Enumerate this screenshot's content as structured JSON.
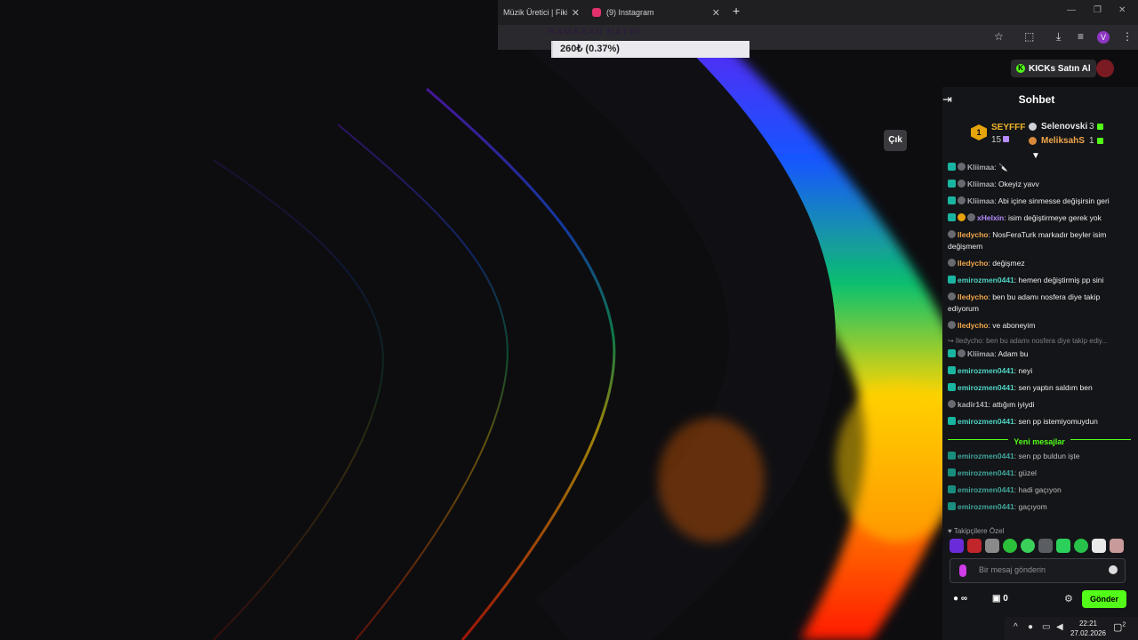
{
  "tabs": [
    {
      "title": "Müzik Üretici | Fikir"
    },
    {
      "title": "(9) Instagram"
    }
  ],
  "toolbar": {
    "avatar_letter": "V"
  },
  "donation": {
    "title": "RAMAZAN HAYRI",
    "amount_label": "260₺ (0.37%)",
    "progress_percent": 0.37
  },
  "page": {
    "cik_label": "Çık"
  },
  "header": {
    "kicks_label": "KICKs Satın Al"
  },
  "chat": {
    "title": "Sohbet",
    "leaderboard": {
      "first": {
        "rank": "1",
        "name": "SEYFFF",
        "count": "15"
      },
      "second": {
        "name": "Selenovski",
        "count": "3"
      },
      "third": {
        "name": "MeliksahS",
        "count": "1"
      }
    },
    "messages": [
      {
        "user": "Kliimaa",
        "text": ": 🔪"
      },
      {
        "user": "Kliimaa",
        "text": ": Okeyiz yavv"
      },
      {
        "user": "Kliimaa",
        "text": ": Abi içine sinmesse değişirsin geri"
      },
      {
        "user": "xHelxin",
        "text": ": isim değiştirmeye gerek yok"
      },
      {
        "user": "Iledycho",
        "text": ": NosFeraTurk markadır beyler isim değişmem"
      },
      {
        "user": "Iledycho",
        "text": ": değişmez"
      },
      {
        "user": "emirozmen0441",
        "text": ": hemen değiştirmiş pp sini"
      },
      {
        "user": "Iledycho",
        "text": ": ben bu adamı nosfera diye takip ediyorum"
      },
      {
        "user": "Iledycho",
        "text": ": ve aboneyim"
      },
      {
        "user": "Kliimaa",
        "text": ": Adam bu"
      },
      {
        "user": "emirozmen0441",
        "text": ": neyi"
      },
      {
        "user": "emirozmen0441",
        "text": ": sen yaptın saldım ben"
      },
      {
        "user": "kadir141",
        "text": ": attığım iyiydi"
      },
      {
        "user": "emirozmen0441",
        "text": ": sen pp istemiyomuydun"
      },
      {
        "user": "emirozmen0441",
        "text": ": sen pp buldun işte"
      },
      {
        "user": "emirozmen0441",
        "text": ": güzel"
      },
      {
        "user": "emirozmen0441",
        "text": ": hadi gaçıyon"
      },
      {
        "user": "emirozmen0441",
        "text": ": gaçıyom"
      }
    ],
    "reply_preview": "↪ Iledycho: ben bu adamı nosfera diye takip ediy...",
    "new_messages_label": "Yeni mesajlar",
    "followers_label": "♥ Takipçilere Özel",
    "input_placeholder": "Bir mesaj gönderin",
    "points": "∞",
    "gifts": "0",
    "send_label": "Gönder"
  },
  "taskbar": {
    "time": "22:21",
    "date": "27.02.2026",
    "notifications": "2"
  },
  "colors": {
    "kick_green": "#53fc18",
    "chat_bg": "#141518"
  }
}
